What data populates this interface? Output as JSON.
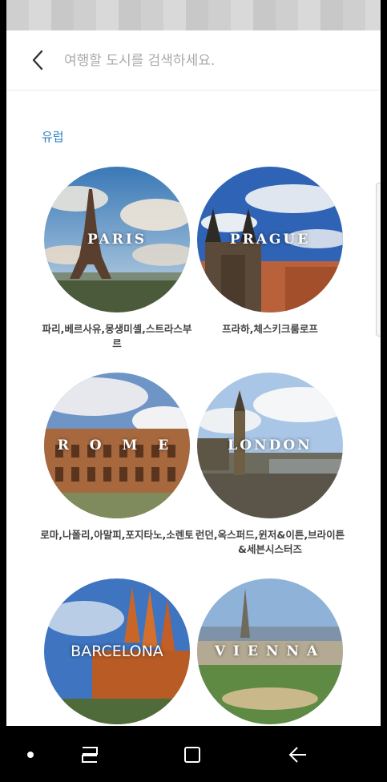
{
  "search": {
    "placeholder": "여행할 도시를 검색하세요."
  },
  "section": {
    "title": "유럽"
  },
  "cities": [
    {
      "name": "PARIS",
      "caption": "파리,베르사유,몽생미셸,스트라스부르"
    },
    {
      "name": "PRAGUE",
      "caption": "프라하,체스키크룸로프"
    },
    {
      "name": "R O M E",
      "caption": "로마,나폴리,아말피,포지타노,소렌토"
    },
    {
      "name": "LONDON",
      "caption": "런던,옥스퍼드,윈저&이튼,브라이튼&세븐시스터즈"
    },
    {
      "name": "BARCELONA",
      "caption": ""
    },
    {
      "name": "VIENNA",
      "caption": ""
    }
  ],
  "colors": {
    "accent": "#2a7fc7",
    "placeholder": "#a9a9a9"
  },
  "icons": {
    "back": "chevron-left-icon",
    "nav_dot": "dot-icon",
    "nav_recents": "recents-icon",
    "nav_home": "home-icon",
    "nav_back": "back-arrow-icon"
  }
}
